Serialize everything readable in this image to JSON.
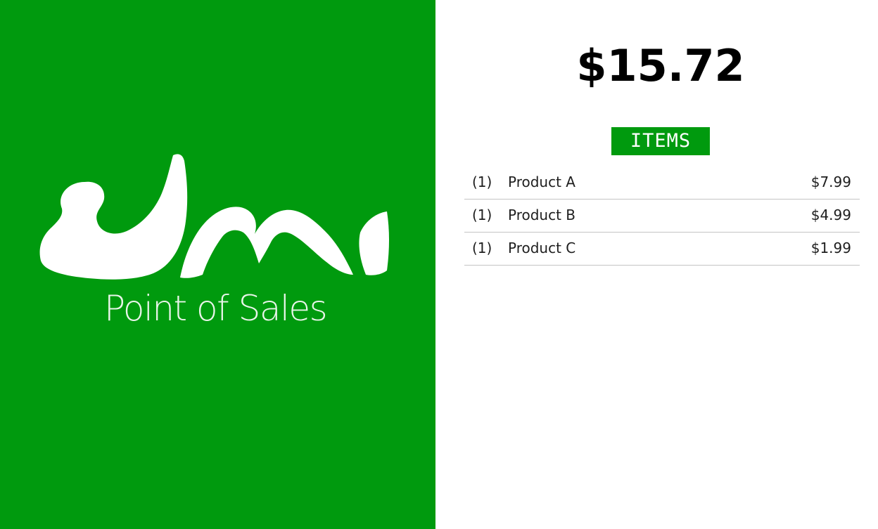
{
  "brand": {
    "logo_text": "umi",
    "tagline": "Point of Sales",
    "color": "#009a0e"
  },
  "order": {
    "total": "$15.72",
    "items_label": "ITEMS",
    "items": [
      {
        "qty": "(1)",
        "name": "Product A",
        "price": "$7.99"
      },
      {
        "qty": "(1)",
        "name": "Product B",
        "price": "$4.99"
      },
      {
        "qty": "(1)",
        "name": "Product C",
        "price": "$1.99"
      }
    ]
  },
  "colors": {
    "accent": "#009a0e",
    "background": "#ffffff",
    "divider": "#c4c4c4"
  }
}
